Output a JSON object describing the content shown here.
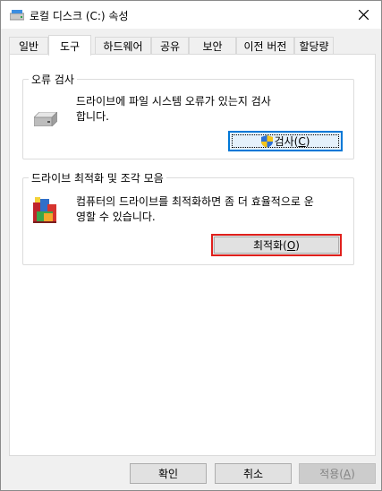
{
  "window": {
    "title": "로컬 디스크 (C:) 속성",
    "title_icon": "drive-icon",
    "close_icon": "close-icon"
  },
  "tabs": [
    {
      "label": "일반",
      "active": false
    },
    {
      "label": "도구",
      "active": true
    },
    {
      "label": "하드웨어",
      "active": false
    },
    {
      "label": "공유",
      "active": false
    },
    {
      "label": "보안",
      "active": false
    },
    {
      "label": "이전 버전",
      "active": false
    },
    {
      "label": "할당량",
      "active": false
    }
  ],
  "error_check": {
    "title": "오류 검사",
    "desc_line1": "드라이브에 파일 시스템 오류가 있는지 검사",
    "desc_line2": "합니다.",
    "button_label": "검사(",
    "button_key": "C",
    "button_end": ")",
    "icon": "hard-drive-icon",
    "button_icon": "uac-shield-icon"
  },
  "optimize": {
    "title": "드라이브 최적화 및 조각 모음",
    "desc_line1": "컴퓨터의 드라이브를 최적화하면 좀 더 효율적으로 운",
    "desc_line2": "영할 수 있습니다.",
    "button_label": "최적화(",
    "button_key": "O",
    "button_end": ")",
    "icon": "defrag-icon"
  },
  "footer": {
    "ok": "확인",
    "cancel": "취소",
    "apply": "적용(",
    "apply_key": "A",
    "apply_end": ")"
  },
  "colors": {
    "focus_blue": "#0078d7",
    "highlight_red": "#e0201c"
  }
}
